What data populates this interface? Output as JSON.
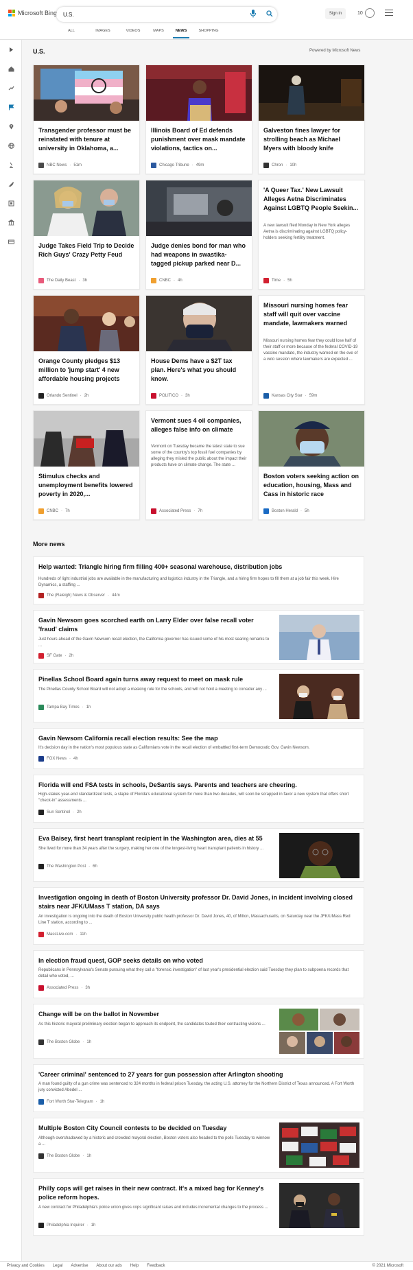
{
  "header": {
    "logo_text": "Microsoft Bing",
    "search_value": "U.S.",
    "signin_label": "Sign in",
    "points": "10"
  },
  "tabs": [
    {
      "label": "ALL"
    },
    {
      "label": "IMAGES"
    },
    {
      "label": "VIDEOS"
    },
    {
      "label": "MAPS"
    },
    {
      "label": "NEWS"
    },
    {
      "label": "SHOPPING"
    }
  ],
  "section": {
    "title": "U.S.",
    "powered_by": "Powered by Microsoft News"
  },
  "cards": [
    {
      "title": "Transgender professor must be reinstated with tenure at university in Oklahoma, a...",
      "source": "NBC News",
      "time": "51m",
      "src_color": "#4a4a4a"
    },
    {
      "title": "Illinois Board of Ed defends punishment over mask mandate violations, tactics on...",
      "source": "Chicago Tribune",
      "time": "49m",
      "src_color": "#2c5aa0"
    },
    {
      "title": "Galveston fines lawyer for strolling beach as Michael Myers with bloody knife",
      "source": "Chron",
      "time": "10h",
      "src_color": "#333333"
    },
    {
      "title": "Judge Takes Field Trip to Decide Rich Guys' Crazy Petty Feud",
      "source": "The Daily Beast",
      "time": "3h",
      "src_color": "#e85a7a"
    },
    {
      "title": "Judge denies bond for man who had weapons in swastika-tagged pickup parked near D...",
      "source": "CNBC",
      "time": "4h",
      "src_color": "#f0a030"
    },
    {
      "title": "'A Queer Tax.' New Lawsuit Alleges Aetna Discriminates Against LGBTQ People Seekin...",
      "summary": "A new lawsuit filed Monday in New York alleges Aetna is discriminating against LGBTQ policy-holders seeking fertility treatment.",
      "source": "Time",
      "time": "5h",
      "src_color": "#d22030"
    },
    {
      "title": "Orange County pledges $13 million to 'jump start' 4 new affordable housing projects",
      "source": "Orlando Sentinel",
      "time": "2h",
      "src_color": "#222222"
    },
    {
      "title": "House Dems have a $2T tax plan. Here's what you should know.",
      "source": "POLITICO",
      "time": "3h",
      "src_color": "#c8102e"
    },
    {
      "title": "Missouri nursing homes fear staff will quit over vaccine mandate, lawmakers warned",
      "summary": "Missouri nursing homes fear they could lose half of their staff or more because of the federal COVID-19 vaccine mandate, the industry warned on the eve of a veto session where lawmakers are expected ...",
      "source": "Kansas City Star",
      "time": "59m",
      "src_color": "#1b5ea8"
    },
    {
      "title": "Stimulus checks and unemployment benefits lowered poverty in 2020,...",
      "source": "CNBC",
      "time": "7h",
      "src_color": "#f0a030"
    },
    {
      "title": "Vermont sues 4 oil companies, alleges false info on climate",
      "summary": "Vermont on Tuesday became the latest state to sue some of the country's top fossil fuel companies by alleging they misled the public about the impact their products have on climate change. The state ...",
      "source": "Associated Press",
      "time": "7h",
      "src_color": "#c8102e"
    },
    {
      "title": "Boston voters seeking action on education, housing, Mass and Cass in historic race",
      "source": "Boston Herald",
      "time": "5h",
      "src_color": "#1a6bc4"
    }
  ],
  "more_news": {
    "title": "More news",
    "items": [
      {
        "title": "Help wanted: Triangle hiring firm filling 400+ seasonal warehouse, distribution jobs",
        "snippet": "Hundreds of light industrial jobs are available in the manufacturing and logistics industry in the Triangle, and a hiring firm hopes to fill them at a job fair this week. Hire Dynamics, a staffing ...",
        "source": "The (Raleigh) News & Observer",
        "time": "44m",
        "src_color": "#b22222"
      },
      {
        "title": "Gavin Newsom goes scorched earth on Larry Elder over false recall voter 'fraud' claims",
        "snippet": "Just hours ahead of the Gavin Newsom recall election, the California governor has issued some of his most searing remarks to ...",
        "source": "SF Gate",
        "time": "2h",
        "src_color": "#d22030"
      },
      {
        "title": "Pinellas School Board again turns away request to meet on mask rule",
        "snippet": "The Pinellas County School Board will not adopt a masking rule for the schools, and will not hold a meeting to consider any ...",
        "source": "Tampa Bay Times",
        "time": "1h",
        "src_color": "#2a8a5a"
      },
      {
        "title": "Gavin Newsom California recall election results: See the map",
        "snippet": "It's decision day in the nation's most populous state as Californians vote in the recall election of embattled first-term Democratic Gov. Gavin Newsom.",
        "source": "FOX News",
        "time": "4h",
        "src_color": "#1b3c8a"
      },
      {
        "title": "Florida will end FSA tests in schools, DeSantis says. Parents and teachers are cheering.",
        "snippet": "High-stakes year-end standardized tests, a staple of Florida's educational system for more than two decades, will soon be scrapped in favor a new system that offers short \"check-in\" assessments ...",
        "source": "Sun Sentinel",
        "time": "2h",
        "src_color": "#222222"
      },
      {
        "title": "Eva Baisey, first heart transplant recipient in the Washington area, dies at 55",
        "snippet": "She lived for more than 34 years after the surgery, making her one of the longest-living heart transplant patients in history ...",
        "source": "The Washington Post",
        "time": "6h",
        "src_color": "#222222"
      },
      {
        "title": "Investigation ongoing in death of Boston University professor Dr. David Jones, in incident involving closed stairs near JFK/UMass T station, DA says",
        "snippet": "An investigation is ongoing into the death of Boston University public health professor Dr. David Jones, 40, of Milton, Massachusetts, on Saturday near the JFK/UMass Red Line T station, according to ...",
        "source": "MassLive.com",
        "time": "11h",
        "src_color": "#d22030"
      },
      {
        "title": "In election fraud quest, GOP seeks details on who voted",
        "snippet": "Republicans in Pennsylvania's Senate pursuing what they call a \"forensic investigation\" of last year's presidential election said Tuesday they plan to subpoena records that detail who voted, ...",
        "source": "Associated Press",
        "time": "3h",
        "src_color": "#c8102e"
      },
      {
        "title": "Change will be on the ballot in November",
        "snippet": "As this historic mayoral preliminary election began to approach its endpoint, the candidates touted their contrasting visions ...",
        "source": "The Boston Globe",
        "time": "1h",
        "src_color": "#333333"
      },
      {
        "title": "'Career criminal' sentenced to 27 years for gun possession after Arlington shooting",
        "snippet": "A man found guilty of a gun crime was sentenced to 324 months in federal prison Tuesday, the acting U.S. attorney for the Northern District of Texas announced. A Fort Worth jury convicted Abedel ...",
        "source": "Fort Worth Star-Telegram",
        "time": "1h",
        "src_color": "#1b5ea8"
      },
      {
        "title": "Multiple Boston City Council contests to be decided on Tuesday",
        "snippet": "Although overshadowed by a historic and crowded mayoral election, Boston voters also headed to the polls Tuesday to winnow a ...",
        "source": "The Boston Globe",
        "time": "1h",
        "src_color": "#333333"
      },
      {
        "title": "Philly cops will get raises in their new contract. It's a mixed bag for Kenney's police reform hopes.",
        "snippet": "A new contract for Philadelphia's police union gives cops significant raises and includes incremental changes to the process ...",
        "source": "Philadelphia Inquirer",
        "time": "1h",
        "src_color": "#222222"
      }
    ]
  },
  "footer": {
    "links": [
      "Privacy and Cookies",
      "Legal",
      "Advertise",
      "About our ads",
      "Help",
      "Feedback"
    ],
    "copyright": "© 2021 Microsoft"
  }
}
